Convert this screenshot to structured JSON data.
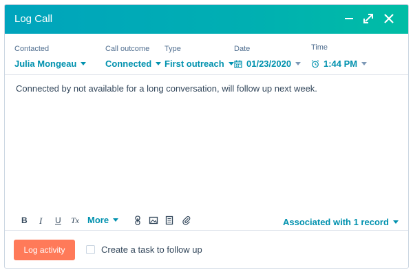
{
  "dialog": {
    "title": "Log Call",
    "header_buttons": [
      "minimize-icon",
      "expand-icon",
      "close-icon"
    ],
    "header_color": "#00a4bd"
  },
  "fields": {
    "contacted": {
      "label": "Contacted",
      "value": "Julia Mongeau"
    },
    "call_outcome": {
      "label": "Call outcome",
      "value": "Connected"
    },
    "type": {
      "label": "Type",
      "value": "First outreach"
    },
    "date": {
      "label": "Date",
      "value": "01/23/2020",
      "icon": "calendar-icon"
    },
    "time": {
      "label": "Time",
      "value": "1:44 PM",
      "icon": "clock-icon"
    }
  },
  "body": {
    "text": "Connected by not available for a long conversation, will follow up next week."
  },
  "toolbar": {
    "bold": "B",
    "italic": "I",
    "underline": "U",
    "clear_format": "Tx",
    "more": "More",
    "icons": [
      "link-icon",
      "image-icon",
      "document-icon",
      "attachment-icon"
    ],
    "associated": "Associated with 1 record"
  },
  "footer": {
    "log_button": "Log activity",
    "log_button_color": "#ff7a59",
    "task_label": "Create a task to follow up",
    "task_checked": false
  },
  "colors": {
    "accent": "#0091ae",
    "text": "#33475b"
  }
}
